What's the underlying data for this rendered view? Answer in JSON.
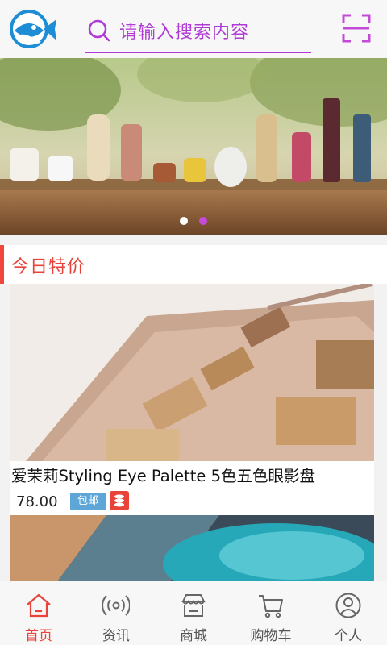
{
  "header": {
    "search_placeholder": "请输入搜索内容",
    "logo_icon": "fish-logo-icon",
    "scan_icon": "scan-icon",
    "search_icon": "search-icon",
    "accent_color": "#b03ad6"
  },
  "banner": {
    "slide_count": 2,
    "active_slide": 2
  },
  "section": {
    "title": "今日特价",
    "accent_color": "#e8423a"
  },
  "products": [
    {
      "title": "爱茉莉Styling Eye Palette 5色五色眼影盘",
      "price": "78.00",
      "tag": "包邮",
      "coin_icon": "coin-icon"
    }
  ],
  "bottom_nav": {
    "items": [
      {
        "label": "首页",
        "icon": "home-icon",
        "active": true
      },
      {
        "label": "资讯",
        "icon": "broadcast-icon",
        "active": false
      },
      {
        "label": "商城",
        "icon": "store-icon",
        "active": false
      },
      {
        "label": "购物车",
        "icon": "cart-icon",
        "active": false
      },
      {
        "label": "个人",
        "icon": "user-icon",
        "active": false
      }
    ]
  }
}
